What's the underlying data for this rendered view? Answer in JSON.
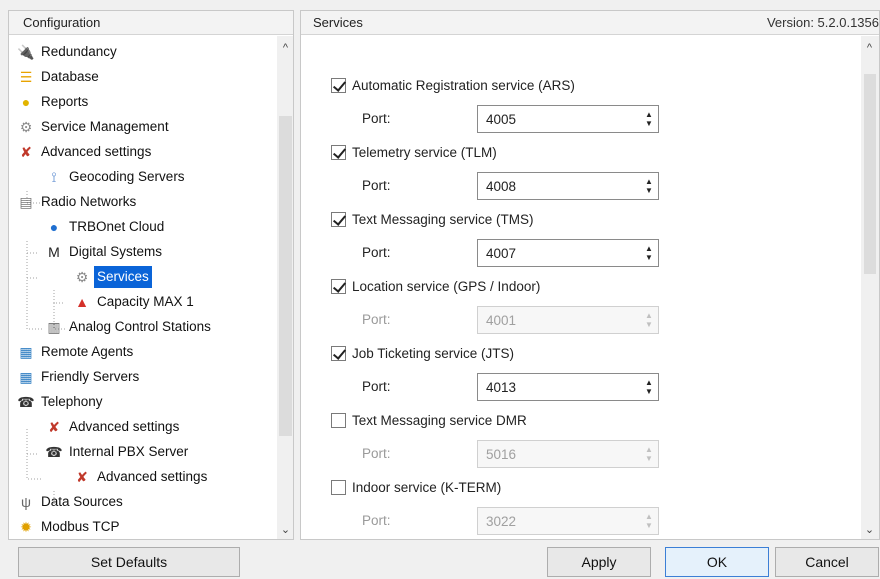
{
  "left": {
    "header": "Configuration",
    "tree": [
      {
        "label": "Redundancy",
        "icon": "plug-icon"
      },
      {
        "label": "Database",
        "icon": "database-icon"
      },
      {
        "label": "Reports",
        "icon": "reports-icon"
      },
      {
        "label": "Service Management",
        "icon": "gear-icon"
      },
      {
        "label": "Advanced settings",
        "icon": "tools-icon"
      },
      {
        "label": "Geocoding Servers",
        "icon": "geocoding-icon"
      },
      {
        "label": "Radio Networks",
        "icon": "radio-network-icon"
      },
      {
        "label": "TRBOnet Cloud",
        "icon": "cloud-icon"
      },
      {
        "label": "Digital Systems",
        "icon": "motorola-icon"
      },
      {
        "label": "Services",
        "icon": "gear-icon"
      },
      {
        "label": "Capacity MAX 1",
        "icon": "capacity-max-icon"
      },
      {
        "label": "Analog Control Stations",
        "icon": "station-icon"
      },
      {
        "label": "Remote Agents",
        "icon": "remote-agents-icon"
      },
      {
        "label": "Friendly Servers",
        "icon": "friendly-servers-icon"
      },
      {
        "label": "Telephony",
        "icon": "telephone-icon"
      },
      {
        "label": "Advanced settings",
        "icon": "tools-icon"
      },
      {
        "label": "Internal PBX Server",
        "icon": "telephone-icon"
      },
      {
        "label": "Advanced settings",
        "icon": "tools-icon"
      },
      {
        "label": "Data Sources",
        "icon": "data-sources-icon"
      },
      {
        "label": "Modbus TCP",
        "icon": "modbus-icon"
      }
    ]
  },
  "right": {
    "header": "Services",
    "version": "Version: 5.2.0.1356",
    "port_label": "Port:",
    "services": [
      {
        "label": "Automatic Registration service (ARS)",
        "checked": true,
        "port": "4005"
      },
      {
        "label": "Telemetry service (TLM)",
        "checked": true,
        "port": "4008"
      },
      {
        "label": "Text Messaging service (TMS)",
        "checked": true,
        "port": "4007"
      },
      {
        "label": "Location service (GPS / Indoor)",
        "checked": true,
        "port": "4001"
      },
      {
        "label": "Job Ticketing service (JTS)",
        "checked": true,
        "port": "4013"
      },
      {
        "label": "Text Messaging service DMR",
        "checked": false,
        "port": "5016"
      },
      {
        "label": "Indoor service (K-TERM)",
        "checked": false,
        "port": "3022"
      }
    ]
  },
  "buttons": {
    "set_defaults": "Set Defaults",
    "apply": "Apply",
    "ok": "OK",
    "cancel": "Cancel"
  },
  "colors": {
    "selection": "#0a64d8",
    "accent_border": "#3c7fd6"
  }
}
